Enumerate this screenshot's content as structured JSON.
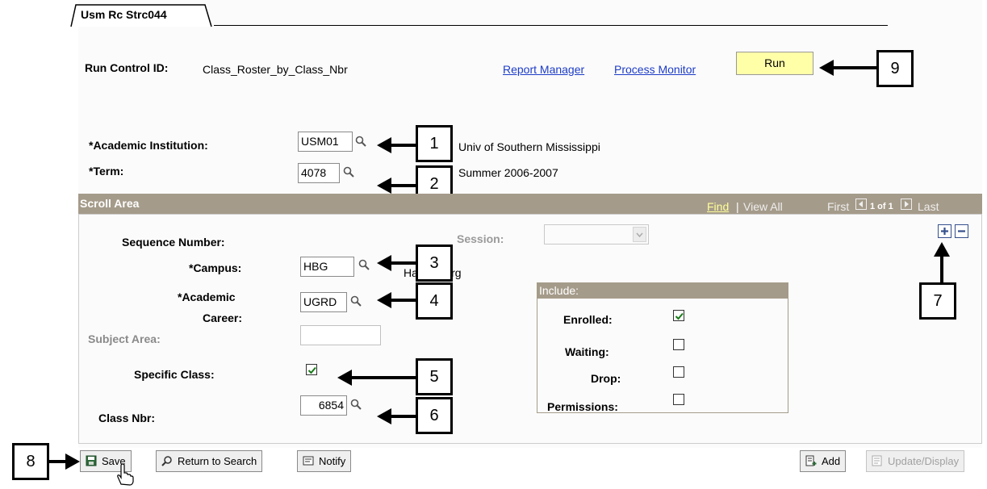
{
  "tab": {
    "label": "Usm Rc Strc044"
  },
  "header": {
    "run_control_label": "Run Control ID:",
    "run_control_value": "Class_Roster_by_Class_Nbr",
    "report_manager": "Report Manager",
    "process_monitor": "Process Monitor",
    "run_button": "Run"
  },
  "fields": {
    "institution_label": "*Academic Institution:",
    "institution_value": "USM01",
    "institution_desc": "Univ of Southern Mississippi",
    "term_label": "*Term:",
    "term_value": "4078",
    "term_desc": "Summer 2006-2007"
  },
  "scroll": {
    "title": "Scroll Area",
    "find": "Find",
    "separator": "|",
    "view_all": "View All",
    "first": "First",
    "count": "1 of 1",
    "last": "Last",
    "sequence_label": "Sequence Number:",
    "session_label": "Session:",
    "campus_label": "*Campus:",
    "campus_value": "HBG",
    "campus_desc": "Hattiesburg",
    "career_label_1": "*Academic",
    "career_label_2": "Career:",
    "career_value": "UGRD",
    "subject_label": "Subject Area:",
    "subject_value": "",
    "specific_label": "Specific Class:",
    "specific_checked": true,
    "classnbr_label": "Class Nbr:",
    "classnbr_value": "6854"
  },
  "include": {
    "title": "Include:",
    "enrolled_label": "Enrolled:",
    "enrolled": true,
    "waiting_label": "Waiting:",
    "waiting": false,
    "drop_label": "Drop:",
    "drop": false,
    "permissions_label": "Permissions:",
    "permissions": false
  },
  "toolbar": {
    "save": "Save",
    "return_to_search": "Return to Search",
    "notify": "Notify",
    "add": "Add",
    "update_display": "Update/Display"
  },
  "callouts": [
    "1",
    "2",
    "3",
    "4",
    "5",
    "6",
    "7",
    "8",
    "9"
  ],
  "colors": {
    "link": "#1d3cc7",
    "run_button": "#ffffa8",
    "scroll_header": "#a59b8a",
    "check": "#1a7a1a"
  }
}
